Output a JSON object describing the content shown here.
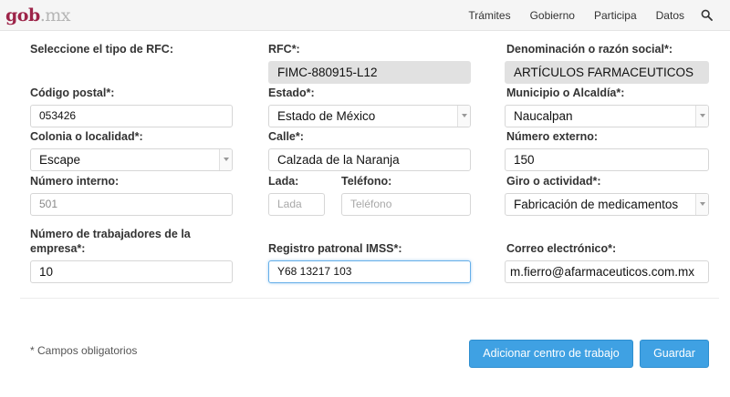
{
  "nav": {
    "brand_main": "gob",
    "brand_ext": ".mx",
    "links": [
      "Trámites",
      "Gobierno",
      "Participa",
      "Datos"
    ],
    "search_icon": "search-icon"
  },
  "form": {
    "tipo_rfc": {
      "label": "Seleccione el tipo de RFC:"
    },
    "rfc": {
      "label": "RFC*:",
      "value": "FIMC-880915-L12"
    },
    "razon_social": {
      "label": "Denominación o razón social*:",
      "value": "ARTÍCULOS FARMACEUTICOS"
    },
    "codigo_postal": {
      "label": "Código postal*:",
      "value": "053426"
    },
    "estado": {
      "label": "Estado*:",
      "value": "Estado de México"
    },
    "municipio": {
      "label": "Municipio o Alcaldía*:",
      "value": "Naucalpan"
    },
    "colonia": {
      "label": "Colonia o localidad*:",
      "value": "Escape"
    },
    "calle": {
      "label": "Calle*:",
      "value": "Calzada de la Naranja"
    },
    "numero_externo": {
      "label": "Número externo:",
      "value": "150"
    },
    "numero_interno": {
      "label": "Número interno:",
      "value": "501"
    },
    "lada": {
      "label": "Lada:",
      "placeholder": "Lada"
    },
    "telefono": {
      "label": "Teléfono:",
      "placeholder": "Teléfono"
    },
    "giro": {
      "label": "Giro o actividad*:",
      "value": "Fabricación de medicamentos"
    },
    "trabajadores": {
      "label_line1": "Número de trabajadores de la",
      "label_line2": "empresa*:",
      "value": "10"
    },
    "imss": {
      "label": "Registro patronal IMSS*:",
      "value": "Y68 13217 103"
    },
    "correo": {
      "label": "Correo electrónico*:",
      "value": "m.fierro@afarmaceuticos.com.mx"
    }
  },
  "footer": {
    "required_note": "* Campos obligatorios",
    "add_button": "Adicionar centro de trabajo",
    "save_button": "Guardar"
  },
  "colors": {
    "brand": "#9d2449",
    "primary_button": "#3fa1e3"
  }
}
